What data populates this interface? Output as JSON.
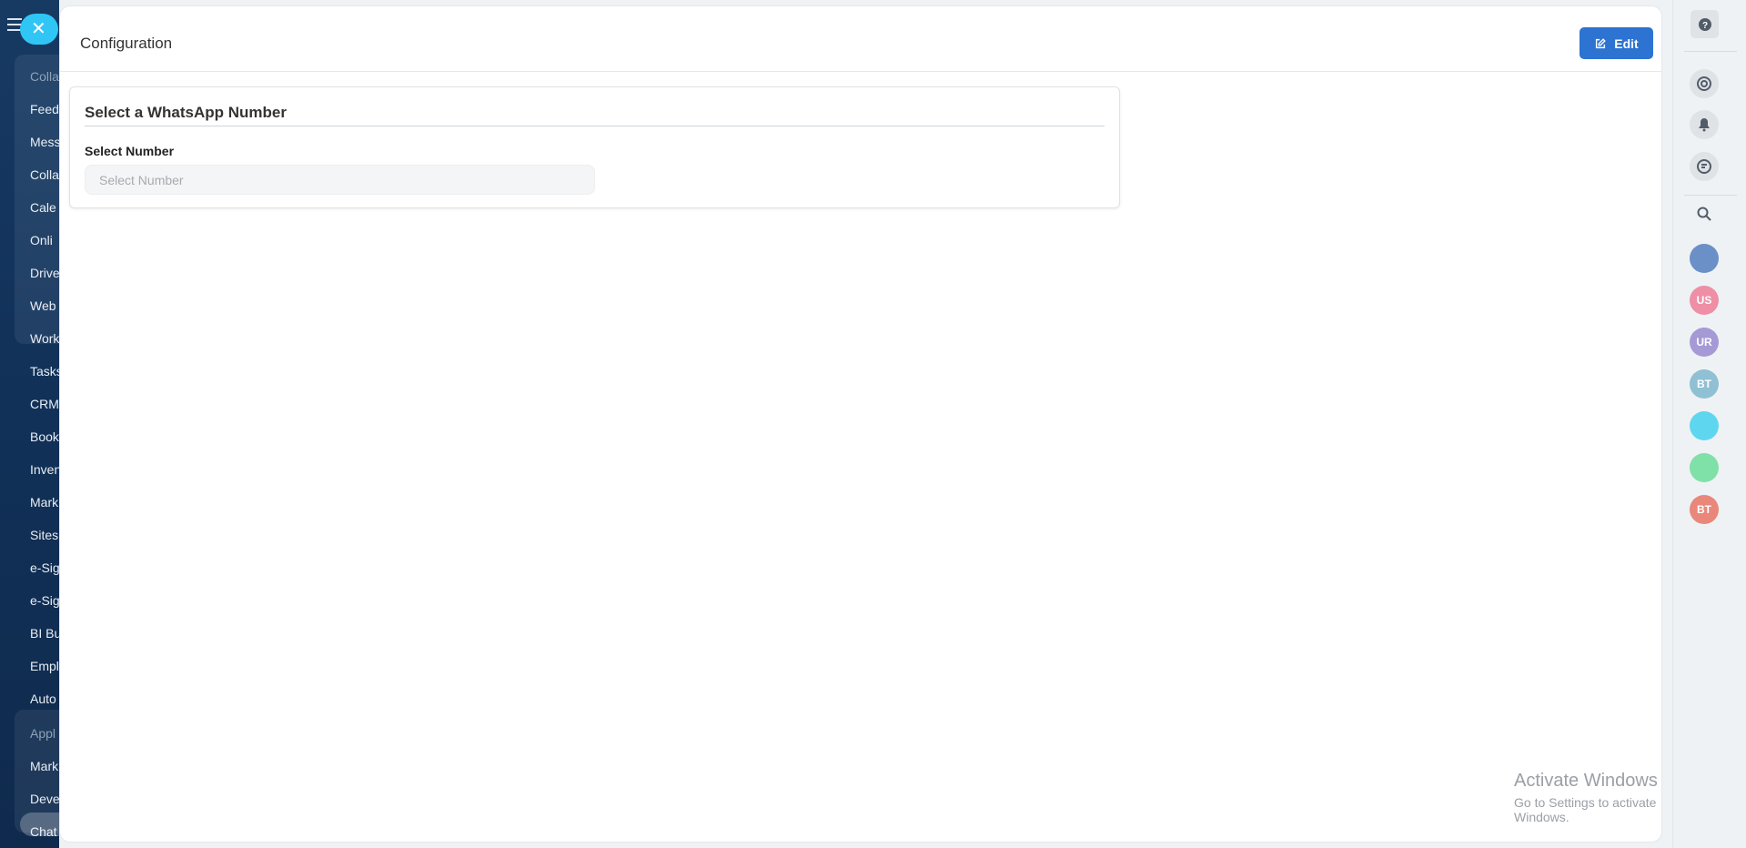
{
  "sidebar": {
    "items": [
      {
        "label": "Colla",
        "dim": true
      },
      {
        "label": "Feed"
      },
      {
        "label": "Mess"
      },
      {
        "label": "Colla"
      },
      {
        "label": "Cale"
      },
      {
        "label": "Onli"
      },
      {
        "label": "Drive"
      },
      {
        "label": "Web"
      },
      {
        "label": "Work"
      },
      {
        "label": "Tasks"
      },
      {
        "label": "CRM"
      },
      {
        "label": "Book"
      },
      {
        "label": "Inven"
      },
      {
        "label": "Mark"
      },
      {
        "label": "Sites"
      },
      {
        "label": "e-Sig"
      },
      {
        "label": "e-Sig"
      },
      {
        "label": "BI Bu"
      },
      {
        "label": "Empl"
      },
      {
        "label": "Auto"
      },
      {
        "label": "Appl",
        "dim": true
      },
      {
        "label": "Mark"
      },
      {
        "label": "Deve"
      },
      {
        "label": "Chat"
      }
    ]
  },
  "header": {
    "title": "Configuration",
    "edit_label": "Edit"
  },
  "section": {
    "title": "Select a WhatsApp Number",
    "field_label": "Select Number",
    "select_placeholder": "Select Number"
  },
  "watermark": {
    "line1": "Activate Windows",
    "line2": "Go to Settings to activate Windows."
  },
  "right_rail": {
    "avatars": [
      {
        "initials": "",
        "color": "#6b8fc7",
        "name": "chat-bubble-avatar"
      },
      {
        "initials": "US",
        "color": "#ee8fa6",
        "name": "user-avatar-us"
      },
      {
        "initials": "UR",
        "color": "#a59ad6",
        "name": "user-avatar-ur"
      },
      {
        "initials": "BT",
        "color": "#8fc0d4",
        "name": "user-avatar-bt"
      },
      {
        "initials": "",
        "color": "#5fd6ef",
        "name": "chat-avatar"
      },
      {
        "initials": "",
        "color": "#7fe0a8",
        "name": "notes-avatar"
      },
      {
        "initials": "BT",
        "color": "#e8877a",
        "name": "user-avatar-bt-2"
      }
    ]
  },
  "colors": {
    "accent": "#2c73d2",
    "close_button": "#2fc6f6"
  }
}
